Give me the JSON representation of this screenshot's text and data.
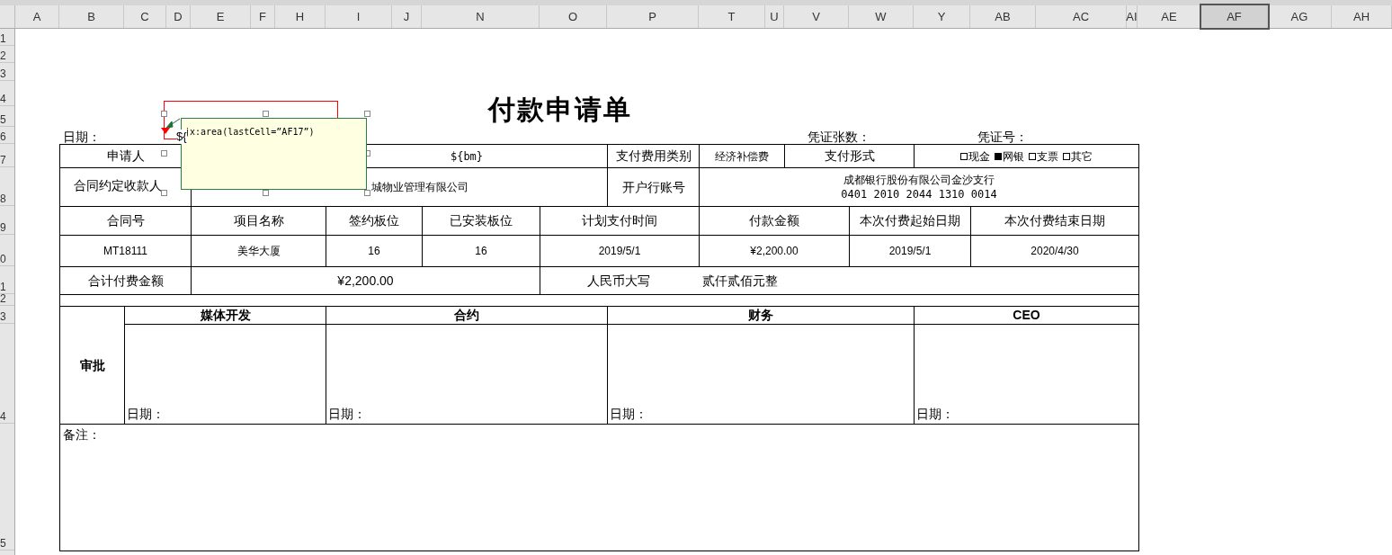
{
  "columns": [
    {
      "label": "A",
      "selected": false
    },
    {
      "label": "B",
      "selected": false
    },
    {
      "label": "C",
      "selected": false
    },
    {
      "label": "D",
      "selected": false
    },
    {
      "label": "E",
      "selected": false
    },
    {
      "label": "F",
      "selected": false
    },
    {
      "label": "H",
      "selected": false
    },
    {
      "label": "I",
      "selected": false
    },
    {
      "label": "J",
      "selected": false
    },
    {
      "label": "N",
      "selected": false
    },
    {
      "label": "O",
      "selected": false
    },
    {
      "label": "P",
      "selected": false
    },
    {
      "label": "T",
      "selected": false
    },
    {
      "label": "U",
      "selected": false
    },
    {
      "label": "V",
      "selected": false
    },
    {
      "label": "W",
      "selected": false
    },
    {
      "label": "Y",
      "selected": false
    },
    {
      "label": "AB",
      "selected": false
    },
    {
      "label": "AC",
      "selected": false
    },
    {
      "label": "AI",
      "selected": false
    },
    {
      "label": "AE",
      "selected": false
    },
    {
      "label": "AF",
      "selected": true
    },
    {
      "label": "AG",
      "selected": false
    },
    {
      "label": "AH",
      "selected": false
    }
  ],
  "row_numbers": [
    "1",
    "2",
    "3",
    "4",
    "5",
    "6",
    "7",
    "8",
    "9",
    "0",
    "1",
    "2",
    "3",
    "4",
    "5"
  ],
  "form": {
    "title": "付款申请单",
    "date_label": "日期：",
    "date_value": "${",
    "voucher_count_label": "凭证张数：",
    "voucher_no_label": "凭证号：",
    "applicant_label": "申请人",
    "department_value": "${bm}",
    "expense_type_label": "支付费用类别",
    "expense_type_value": "经济补偿费",
    "payment_method_label": "支付形式",
    "payment_options": [
      {
        "label": "现金",
        "checked": false
      },
      {
        "label": "网银",
        "checked": true
      },
      {
        "label": "支票",
        "checked": false
      },
      {
        "label": "其它",
        "checked": false
      }
    ],
    "payee_label": "合同约定收款人",
    "payee_value": "城物业管理有限公司",
    "bank_label": "开户行账号",
    "bank_name": "成都银行股份有限公司金沙支行",
    "bank_account": "0401 2010 2044 1310 0014",
    "table_headers": [
      "合同号",
      "项目名称",
      "签约板位",
      "已安装板位",
      "计划支付时间",
      "付款金额",
      "本次付费起始日期",
      "本次付费结束日期"
    ],
    "table_values": [
      "MT18111",
      "美华大厦",
      "16",
      "16",
      "2019/5/1",
      "¥2,200.00",
      "2019/5/1",
      "2020/4/30"
    ],
    "total_label": "合计付费金额",
    "total_value": "¥2,200.00",
    "rmb_label": "人民币大写",
    "rmb_value": "贰仟贰佰元整",
    "approval_label": "审批",
    "approvers": [
      {
        "title": "媒体开发",
        "date_label": "日期："
      },
      {
        "title": "合约",
        "date_label": "日期："
      },
      {
        "title": "财务",
        "date_label": "日期："
      },
      {
        "title": "CEO",
        "date_label": "日期："
      }
    ],
    "remarks_label": "备注："
  },
  "comment": {
    "text": "jx:area(lastCell=”AF17”)"
  }
}
